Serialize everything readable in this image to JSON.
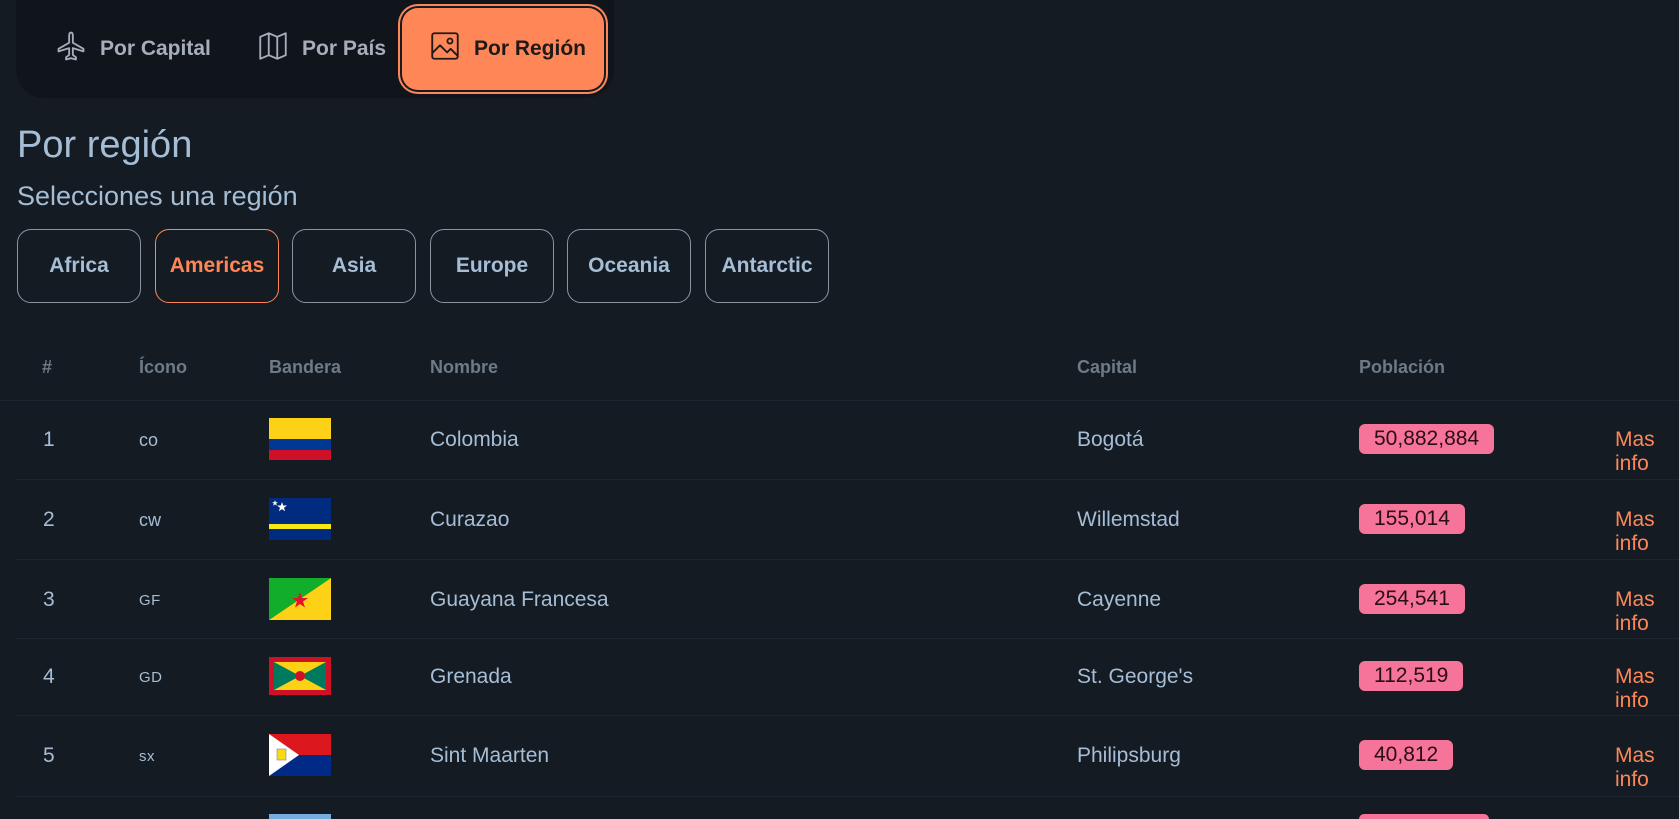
{
  "nav": {
    "items": [
      {
        "label": "Por Capital",
        "icon": "airplane-icon"
      },
      {
        "label": "Por País",
        "icon": "map-icon"
      },
      {
        "label": "Por Región",
        "icon": "image-icon",
        "active": true
      }
    ]
  },
  "page": {
    "title": "Por región",
    "subtitle": "Selecciones una región"
  },
  "regions": [
    {
      "label": "Africa"
    },
    {
      "label": "Americas",
      "active": true
    },
    {
      "label": "Asia"
    },
    {
      "label": "Europe"
    },
    {
      "label": "Oceania"
    },
    {
      "label": "Antarctic"
    }
  ],
  "table": {
    "headers": {
      "num": "#",
      "icon": "Ícono",
      "flag": "Bandera",
      "name": "Nombre",
      "capital": "Capital",
      "population": "Población"
    },
    "rows": [
      {
        "num": "1",
        "icon": "co",
        "name": "Colombia",
        "capital": "Bogotá",
        "population": "50,882,884",
        "action": "Mas info",
        "flag": "colombia-flag"
      },
      {
        "num": "2",
        "icon": "cw",
        "name": "Curazao",
        "capital": "Willemstad",
        "population": "155,014",
        "action": "Mas info",
        "flag": "curacao-flag"
      },
      {
        "num": "3",
        "icon": "GF",
        "name": "Guayana Francesa",
        "capital": "Cayenne",
        "population": "254,541",
        "action": "Mas info",
        "flag": "french-guiana-flag"
      },
      {
        "num": "4",
        "icon": "GD",
        "name": "Grenada",
        "capital": "St. George's",
        "population": "112,519",
        "action": "Mas info",
        "flag": "grenada-flag"
      },
      {
        "num": "5",
        "icon": "sx",
        "name": "Sint Maarten",
        "capital": "Philipsburg",
        "population": "40,812",
        "action": "Mas info",
        "flag": "sint-maarten-flag"
      }
    ]
  },
  "colors": {
    "accent": "#ff8657",
    "badge": "#f6739a",
    "background": "#141b23"
  }
}
